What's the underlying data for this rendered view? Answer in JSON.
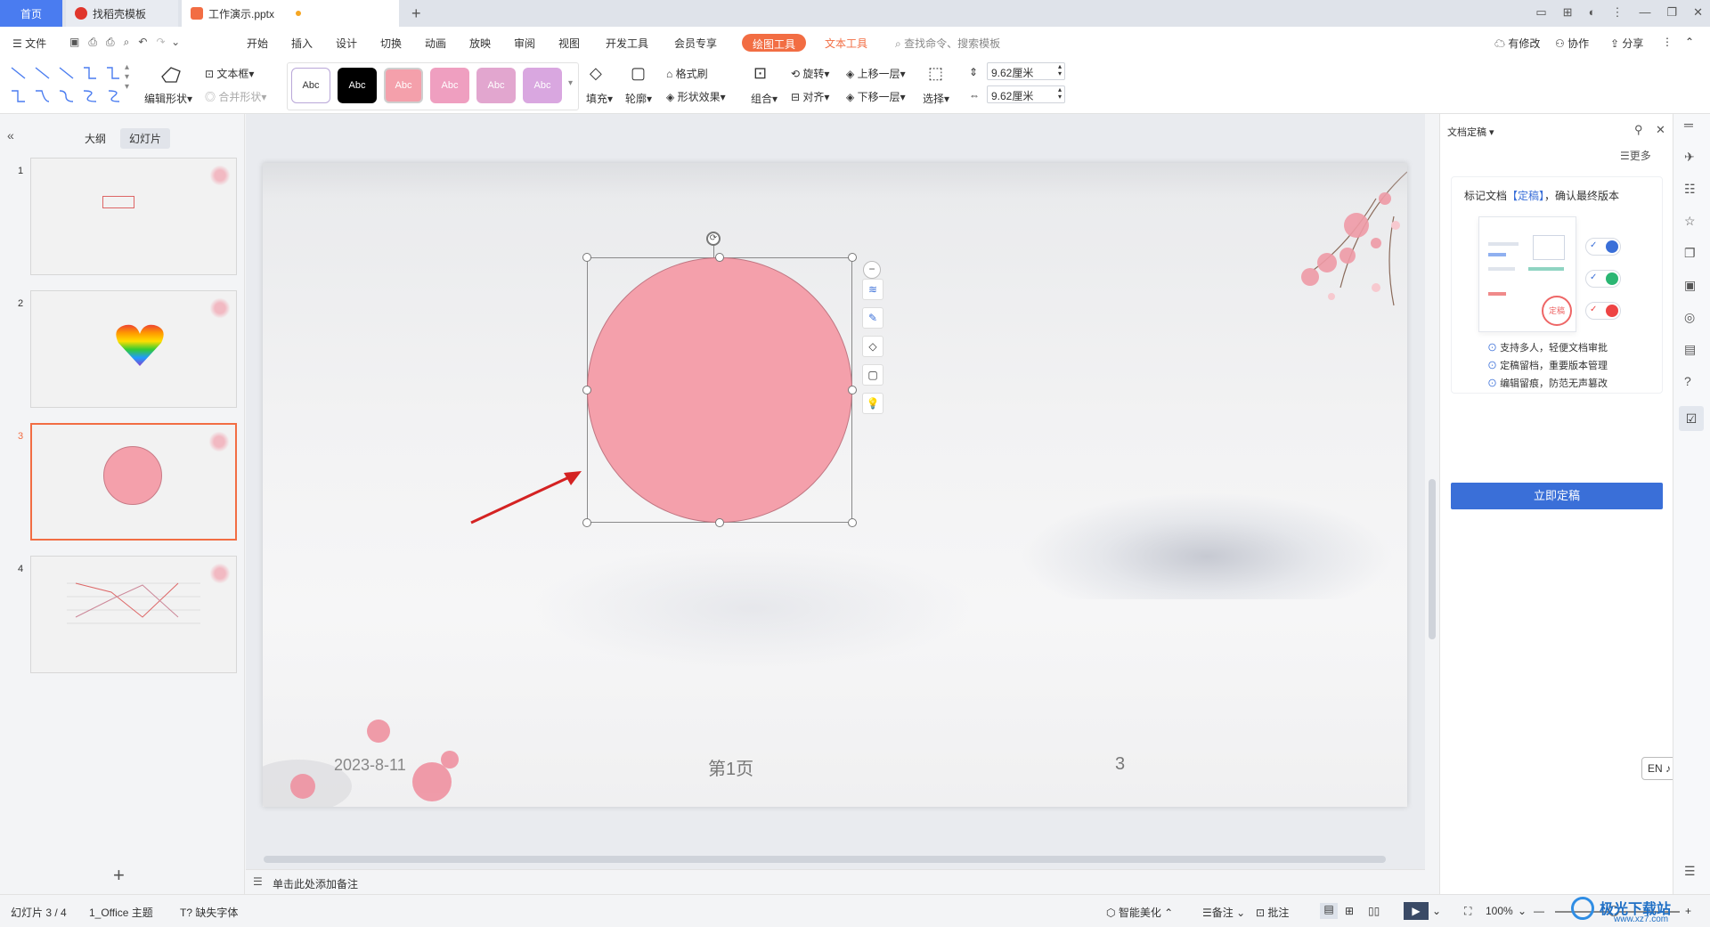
{
  "tabs": {
    "home": "首页",
    "templates": "找稻壳模板",
    "doc": "工作演示.pptx"
  },
  "menu": {
    "file": "文件",
    "items": [
      "开始",
      "插入",
      "设计",
      "切换",
      "动画",
      "放映",
      "审阅",
      "视图",
      "开发工具",
      "会员专享"
    ],
    "drawing_tools": "绘图工具",
    "text_tools": "文本工具",
    "search_placeholder": "查找命令、搜索模板",
    "modified": "有修改",
    "collaborate": "协作",
    "share": "分享"
  },
  "ribbon": {
    "edit_shape": "编辑形状",
    "textbox": "文本框",
    "merge_shape": "合并形状",
    "style_sample": "Abc",
    "fill": "填充",
    "outline": "轮廓",
    "format_painter": "格式刷",
    "shape_effects": "形状效果",
    "rotate": "旋转",
    "bring_forward": "上移一层",
    "group": "组合",
    "align": "对齐",
    "send_backward": "下移一层",
    "select": "选择",
    "height": "9.62厘米",
    "width": "9.62厘米",
    "colors": {
      "accent": "#f26d43",
      "shape_fill": "#f4a0ab",
      "style_pink": "#f4a0ab",
      "style_pink2": "#ef9fc0",
      "style_mauve": "#e2a6cf",
      "style_purple": "#d9a7e0"
    }
  },
  "left_panel": {
    "outline_tab": "大纲",
    "slides_tab": "幻灯片",
    "slide_numbers": [
      "1",
      "2",
      "3",
      "4"
    ],
    "add_icon": "plus-icon"
  },
  "slide": {
    "date": "2023-8-11",
    "page_label": "第1页",
    "page_number": "3"
  },
  "notes": {
    "placeholder": "单击此处添加备注"
  },
  "right_panel": {
    "title": "文档定稿",
    "more": "更多",
    "headline_prefix": "标记文档",
    "headline_highlight": "【定稿】",
    "headline_suffix": "，确认最终版本",
    "stamp": "定稿",
    "features": [
      "支持多人，轻便文档审批",
      "定稿留档，重要版本管理",
      "编辑留痕，防范无声篡改"
    ],
    "button": "立即定稿",
    "ime": "EN ♪ 简"
  },
  "status": {
    "slide_count": "幻灯片 3 / 4",
    "theme": "1_Office 主题",
    "missing_font": "缺失字体",
    "smart_beautify": "智能美化",
    "notes": "备注",
    "comments": "批注",
    "zoom": "100%",
    "watermark": "极光下载站",
    "watermark_url": "www.xz7.com"
  }
}
